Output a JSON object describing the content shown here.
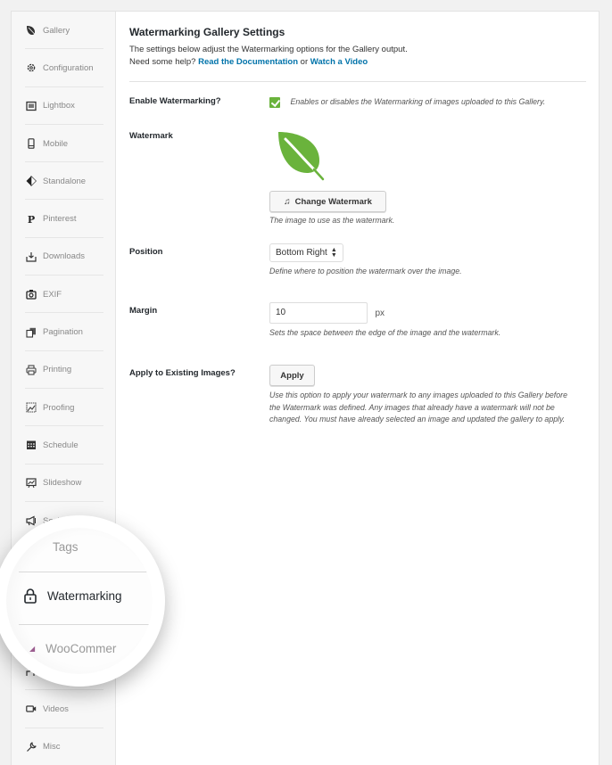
{
  "sidebar": {
    "items": [
      {
        "label": "Gallery",
        "icon": "leaf-icon"
      },
      {
        "label": "Configuration",
        "icon": "gear-icon"
      },
      {
        "label": "Lightbox",
        "icon": "lightbox-icon"
      },
      {
        "label": "Mobile",
        "icon": "mobile-icon"
      },
      {
        "label": "Standalone",
        "icon": "standalone-icon"
      },
      {
        "label": "Pinterest",
        "icon": "pinterest-icon"
      },
      {
        "label": "Downloads",
        "icon": "download-icon"
      },
      {
        "label": "EXIF",
        "icon": "camera-icon"
      },
      {
        "label": "Pagination",
        "icon": "pagination-icon"
      },
      {
        "label": "Printing",
        "icon": "printer-icon"
      },
      {
        "label": "Proofing",
        "icon": "proofing-icon"
      },
      {
        "label": "Schedule",
        "icon": "calendar-icon"
      },
      {
        "label": "Slideshow",
        "icon": "slideshow-icon"
      },
      {
        "label": "Social",
        "icon": "megaphone-icon"
      },
      {
        "label": "Tags",
        "icon": "tag-icon"
      },
      {
        "label": "Watermarking",
        "icon": "lock-icon"
      },
      {
        "label": "WooCommerce",
        "icon": "woocommerce-icon"
      },
      {
        "label": "",
        "icon": "users-icon"
      },
      {
        "label": "Videos",
        "icon": "video-icon"
      },
      {
        "label": "Misc",
        "icon": "wrench-icon"
      }
    ],
    "active": "Watermarking"
  },
  "magnifier": {
    "tags_label": "Tags",
    "watermarking_label": "Watermarking",
    "woocommerce_label": "WooCommer"
  },
  "main": {
    "title": "Watermarking Gallery Settings",
    "intro_line1": "The settings below adjust the Watermarking options for the Gallery output.",
    "intro_help": "Need some help?",
    "doc_link": "Read the Documentation",
    "or": "or",
    "video_link": "Watch a Video",
    "link_color": "#0073aa",
    "fields": {
      "enable": {
        "label": "Enable Watermarking?",
        "checked": true,
        "description": "Enables or disables the Watermarking of images uploaded to this Gallery.",
        "check_color": "#6ab33c"
      },
      "watermark": {
        "label": "Watermark",
        "image": "green-leaf",
        "image_color": "#6ab33c",
        "button_label": "Change Watermark",
        "description": "The image to use as the watermark."
      },
      "position": {
        "label": "Position",
        "value": "Bottom Right",
        "description": "Define where to position the watermark over the image."
      },
      "margin": {
        "label": "Margin",
        "value": "10",
        "unit": "px",
        "description": "Sets the space between the edge of the image and the watermark."
      },
      "apply": {
        "label": "Apply to Existing Images?",
        "button_label": "Apply",
        "description": "Use this option to apply your watermark to any images uploaded to this Gallery before the Watermark was defined. Any images that already have a watermark will not be changed. You must have already selected an image and updated the gallery to apply."
      }
    }
  }
}
